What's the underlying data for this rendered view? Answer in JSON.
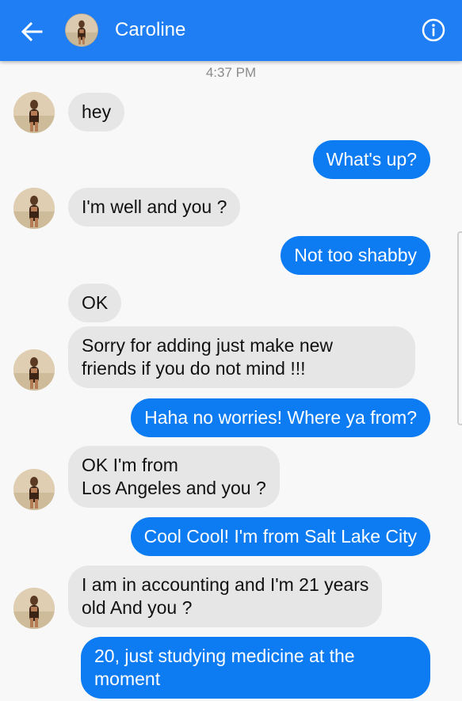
{
  "header": {
    "contact_name": "Caroline",
    "back_icon": "arrow-left-icon",
    "info_icon": "info-icon",
    "color": "#1f7ef3"
  },
  "conversation": {
    "timestamp": "4:37 PM",
    "messages": [
      {
        "from": "them",
        "lines": [
          "hey"
        ]
      },
      {
        "from": "me",
        "lines": [
          "What's up?"
        ]
      },
      {
        "from": "them",
        "lines": [
          "I'm well and you ?"
        ]
      },
      {
        "from": "me",
        "lines": [
          "Not too shabby"
        ]
      },
      {
        "from": "them",
        "lines": [
          "OK"
        ]
      },
      {
        "from": "them",
        "lines": [
          "Sorry for adding just make new",
          "friends if you do not mind !!!"
        ]
      },
      {
        "from": "me",
        "lines": [
          "Haha no worries! Where ya from?"
        ]
      },
      {
        "from": "them",
        "lines": [
          "OK I'm from",
          "Los Angeles and you ?"
        ]
      },
      {
        "from": "me",
        "lines": [
          "Cool Cool! I'm from Salt Lake City"
        ]
      },
      {
        "from": "them",
        "lines": [
          "I am in accounting and I'm 21 years",
          "old And you ?"
        ]
      },
      {
        "from": "me",
        "lines": [
          "20, just studying medicine at the",
          "moment"
        ]
      }
    ]
  },
  "colors": {
    "incoming_bubble": "#e6e6e6",
    "outgoing_bubble": "#0d7cf2",
    "background": "#f8f8f8"
  }
}
